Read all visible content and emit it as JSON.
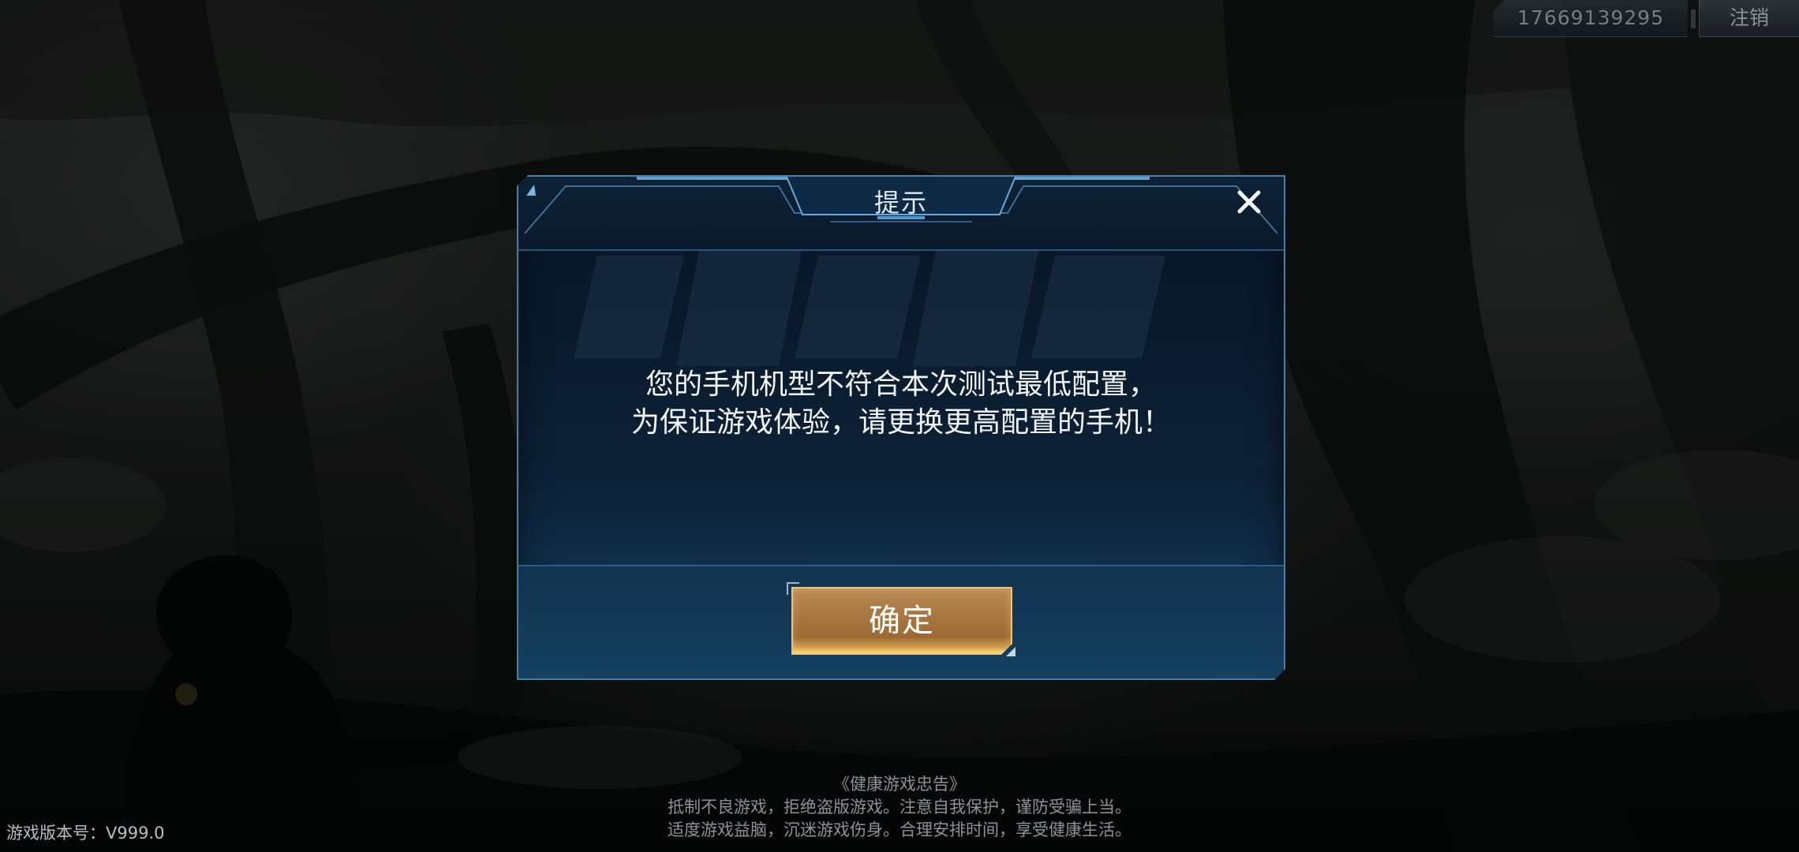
{
  "account": {
    "phone": "17669139295",
    "logout_label": "注销"
  },
  "dialog": {
    "title": "提示",
    "message_lines": [
      "您的手机机型不符合本次测试最低配置，",
      "为保证游戏体验，请更换更高配置的手机！"
    ],
    "confirm_label": "确定",
    "close_icon": "close-icon"
  },
  "footer": {
    "version": "游戏版本号：V999.0",
    "health_notice": [
      "《健康游戏忠告》",
      "抵制不良游戏，拒绝盗版游戏。注意自我保护，谨防受骗上当。",
      "适度游戏益脑，沉迷游戏伤身。合理安排时间，享受健康生活。"
    ]
  },
  "colors": {
    "dialog_border": "#4a7ea7",
    "confirm_gold": "#b88a55"
  }
}
